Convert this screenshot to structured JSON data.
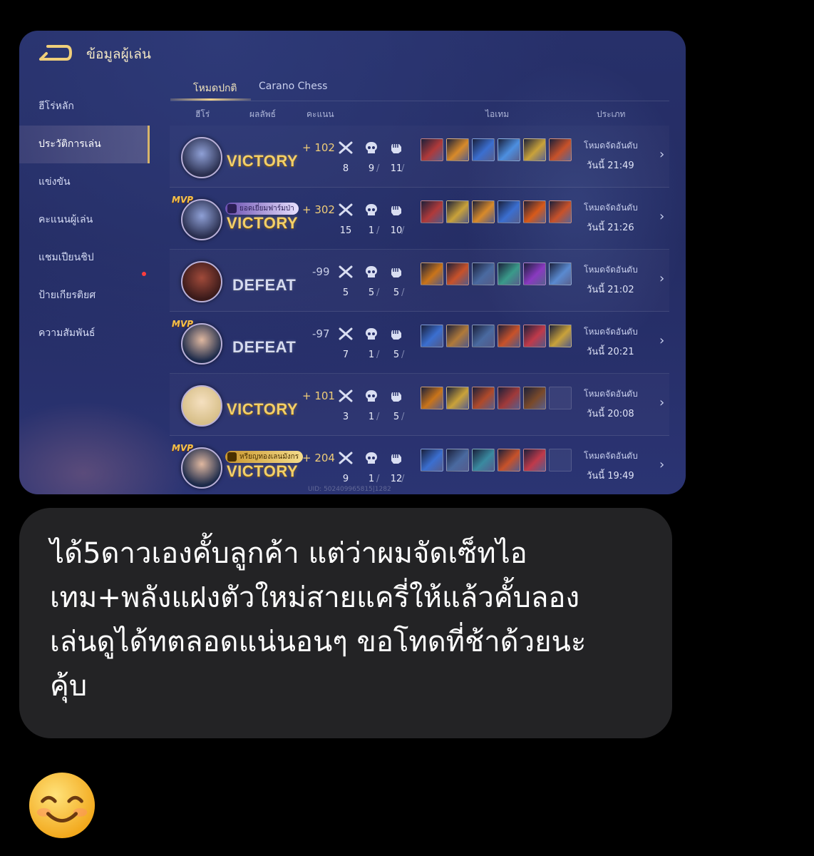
{
  "header": {
    "title": "ข้อมูลผู้เล่น"
  },
  "sidebar": {
    "items": [
      {
        "label": "ฮีโร่หลัก"
      },
      {
        "label": "ประวัติการเล่น",
        "active": true
      },
      {
        "label": "แข่งขัน"
      },
      {
        "label": "คะแนนผู้เล่น"
      },
      {
        "label": "แชมเปียนชิป"
      },
      {
        "label": "ป้ายเกียรติยศ"
      },
      {
        "label": "ความสัมพันธ์"
      }
    ]
  },
  "tabs": [
    {
      "label": "โหมดปกติ",
      "active": true
    },
    {
      "label": "Carano Chess"
    }
  ],
  "columns": {
    "hero": "ฮีโร่",
    "result": "ผลลัพธ์",
    "score": "คะแนน",
    "items": "ไอเทม",
    "type": "ประเภท"
  },
  "matches": [
    {
      "mvp": "",
      "badge": "",
      "result": "VICTORY",
      "score": "+ 102",
      "kills": "8",
      "deaths": "9",
      "assists": "11",
      "mode": "โหมดจัดอันดับ",
      "time": "วันนี้ 21:49",
      "avatar_colors": [
        "#2a2f4f",
        "#8fa0d6"
      ],
      "items": [
        "#b03a3a",
        "#d88a2a",
        "#3b6fd0",
        "#4d8fe0",
        "#c9a23a",
        "#c8522a"
      ]
    },
    {
      "mvp": "MVP",
      "badge": "ยอดเยี่ยมฟาร์มป่า",
      "badge_style": "purple",
      "result": "VICTORY",
      "score": "+ 302",
      "kills": "15",
      "deaths": "1",
      "assists": "10",
      "mode": "โหมดจัดอันดับ",
      "time": "วันนี้ 21:26",
      "avatar_colors": [
        "#2a2f4f",
        "#8fa0d6"
      ],
      "items": [
        "#b03a3a",
        "#c9a23a",
        "#d88a2a",
        "#3b6fd0",
        "#d85a1a",
        "#c8522a"
      ]
    },
    {
      "mvp": "",
      "badge": "",
      "result": "DEFEAT",
      "score": "-99",
      "kills": "5",
      "deaths": "5",
      "assists": "5",
      "mode": "โหมดจัดอันดับ",
      "time": "วันนี้ 21:02",
      "avatar_colors": [
        "#3a1a1a",
        "#a04a3a"
      ],
      "items": [
        "#c9741a",
        "#c8522a",
        "#4a6aa0",
        "#3a9a8a",
        "#8a3ac0",
        "#5a8ad0"
      ]
    },
    {
      "mvp": "MVP",
      "badge": "",
      "result": "DEFEAT",
      "score": "-97",
      "kills": "7",
      "deaths": "1",
      "assists": "5",
      "mode": "โหมดจัดอันดับ",
      "time": "วันนี้ 20:21",
      "avatar_colors": [
        "#1c2a4a",
        "#e0b8a0"
      ],
      "items": [
        "#3b6fd0",
        "#b07a3a",
        "#4a6aa0",
        "#c8522a",
        "#c03a4a",
        "#c9a23a"
      ]
    },
    {
      "mvp": "",
      "badge": "",
      "result": "VICTORY",
      "score": "+ 101",
      "kills": "3",
      "deaths": "1",
      "assists": "5",
      "mode": "โหมดจัดอันดับ",
      "time": "วันนี้ 20:08",
      "avatar_colors": [
        "#d8c08a",
        "#f5e0c0"
      ],
      "items": [
        "#c9741a",
        "#c9a23a",
        "#b04a2a",
        "#a03a3a",
        "#7a4a2a",
        ""
      ]
    },
    {
      "mvp": "MVP",
      "badge": "หรียญทองเลนมังกร",
      "badge_style": "gold",
      "result": "VICTORY",
      "score": "+ 204",
      "kills": "9",
      "deaths": "1",
      "assists": "12",
      "mode": "โหมดจัดอันดับ",
      "time": "วันนี้ 19:49",
      "avatar_colors": [
        "#1c2a4a",
        "#e0b8a0"
      ],
      "items": [
        "#3b6fd0",
        "#4a6aa0",
        "#3a8aa0",
        "#c8522a",
        "#c03a4a",
        ""
      ]
    }
  ],
  "uid": "UID: 502409965815|1282",
  "message": {
    "text": "ได้5ดาวเองคั้บลูกค้า แต่ว่าผมจัดเซ็ทไอ\nเทม+พลังแฝงตัวใหม่สายแครี่ให้แล้วคั้บลอง\nเล่นดูได้ทตลอดแน่นอนๆ ขอโทดที่ช้าด้วยนะ\nคุ้บ"
  },
  "reaction": {
    "icon": "smiling-face-emoji"
  },
  "colors": {
    "gold": "#f2cf6a",
    "panel": "#27306a",
    "bubble": "#232325"
  }
}
